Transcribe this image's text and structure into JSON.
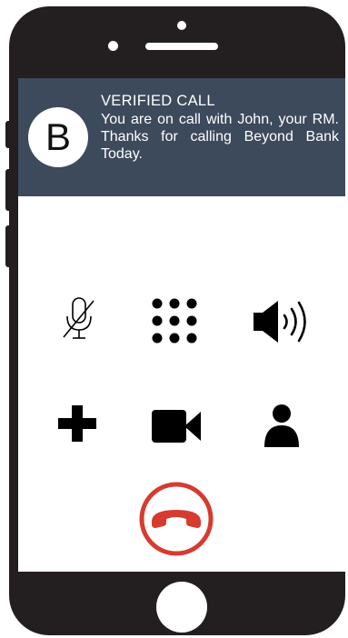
{
  "banner": {
    "avatar_letter": "B",
    "title": "VERIFIED CALL",
    "message": "You are on call with John, your RM. Thanks for calling Beyond Bank Today."
  },
  "controls": {
    "row1": [
      "mute-icon",
      "keypad-icon",
      "speaker-icon"
    ],
    "row2": [
      "add-call-icon",
      "video-icon",
      "contacts-icon"
    ],
    "end_call": "end-call-icon"
  },
  "colors": {
    "phone_body": "#231f20",
    "banner_bg": "#3d4a5c",
    "end_call_red": "#d63b2f",
    "icon_black": "#000000"
  }
}
